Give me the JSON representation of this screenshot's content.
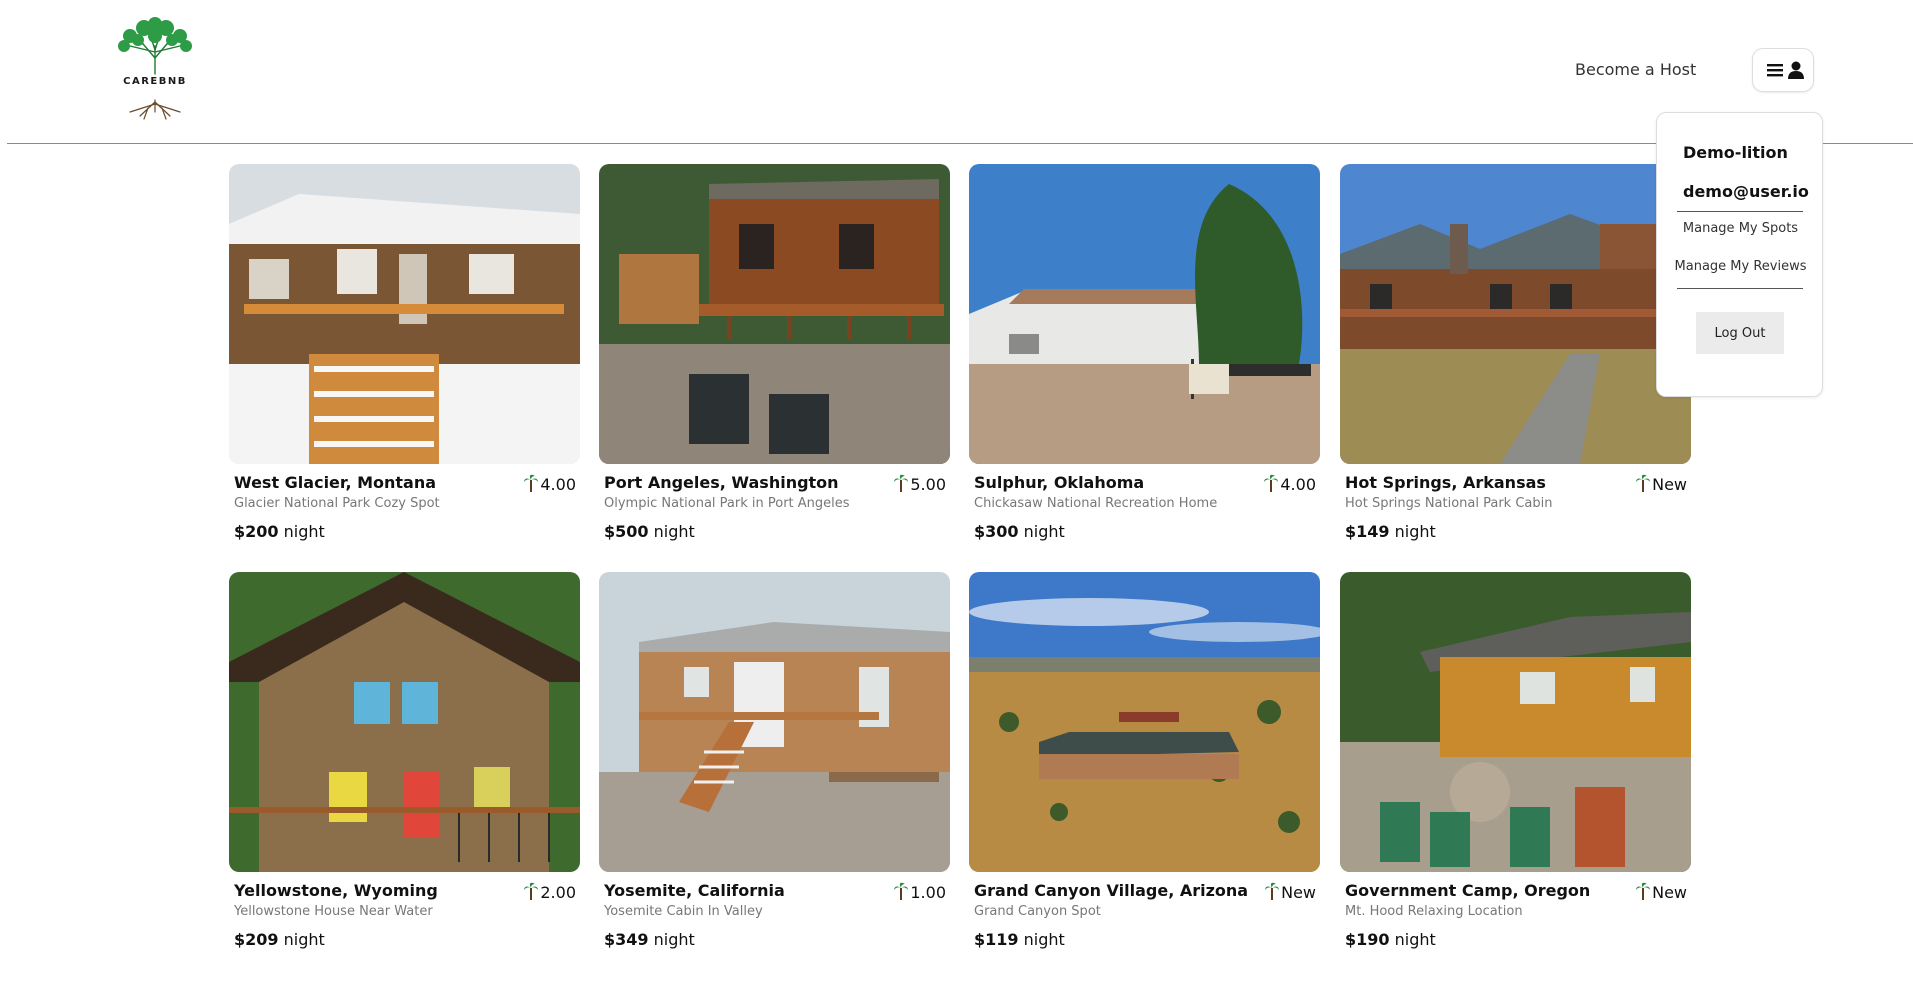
{
  "header": {
    "logo_text": "CAREBNB",
    "become_host": "Become a Host"
  },
  "dropdown": {
    "username": "Demo-lition",
    "email": "demo@user.io",
    "manage_spots": "Manage My Spots",
    "manage_reviews": "Manage My Reviews",
    "logout": "Log Out"
  },
  "night_label": "night",
  "spots": [
    {
      "title": "West Glacier, Montana",
      "rating": "4.00",
      "description": "Glacier National Park Cozy Spot",
      "price": "$200"
    },
    {
      "title": "Port Angeles, Washington",
      "rating": "5.00",
      "description": "Olympic National Park in Port Angeles",
      "price": "$500"
    },
    {
      "title": "Sulphur, Oklahoma",
      "rating": "4.00",
      "description": "Chickasaw National Recreation Home",
      "price": "$300"
    },
    {
      "title": "Hot Springs, Arkansas",
      "rating": "New",
      "description": "Hot Springs National Park Cabin",
      "price": "$149"
    },
    {
      "title": "Yellowstone, Wyoming",
      "rating": "2.00",
      "description": "Yellowstone House Near Water",
      "price": "$209"
    },
    {
      "title": "Yosemite, California",
      "rating": "1.00",
      "description": "Yosemite Cabin In Valley",
      "price": "$349"
    },
    {
      "title": "Grand Canyon Village, Arizona",
      "rating": "New",
      "description": "Grand Canyon Spot",
      "price": "$119"
    },
    {
      "title": "Government Camp, Oregon",
      "rating": "New",
      "description": "Mt. Hood Relaxing Location",
      "price": "$190"
    }
  ],
  "icons": {
    "logo": "tree-logo-icon",
    "menu": "hamburger-icon",
    "user": "user-icon",
    "rating": "palm-tree-icon"
  },
  "colors": {
    "brand_green": "#1f8a3a",
    "divider": "#8a8a8a"
  }
}
